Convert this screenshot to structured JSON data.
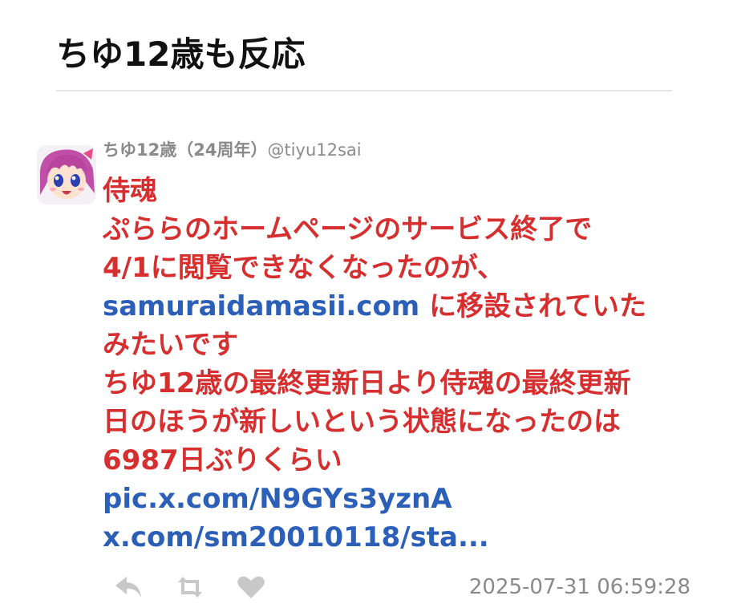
{
  "page": {
    "title": "ちゆ12歳も反応"
  },
  "tweet": {
    "author_name": "ちゆ12歳（24周年）",
    "author_handle": "@tiyu12sai",
    "lines": {
      "l1": "侍魂",
      "l2": "ぷららのホームページのサービス終了で",
      "l3": "4/1に閲覧できなくなったのが、",
      "l4_link": "samuraidamasii.com",
      "l4_text": " に移設されていた",
      "l5": "みたいです",
      "l6": "ちゆ12歳の最終更新日より侍魂の最終更新",
      "l7": "日のほうが新しいという状態になったのは",
      "l8": "6987日ぶりくらい",
      "l9_link": "pic.x.com/N9GYs3yznA",
      "l10_link": "x.com/sm20010118/sta..."
    },
    "timestamp": "2025-07-31 06:59:28",
    "icons": {
      "avatar": "avatar-image",
      "reply": "reply-icon",
      "retweet": "retweet-icon",
      "like": "heart-icon"
    },
    "colors": {
      "body_text": "#d62f2f",
      "link": "#2b5fb8",
      "meta": "#8a8a8a",
      "icon": "#c8c8c8"
    }
  }
}
